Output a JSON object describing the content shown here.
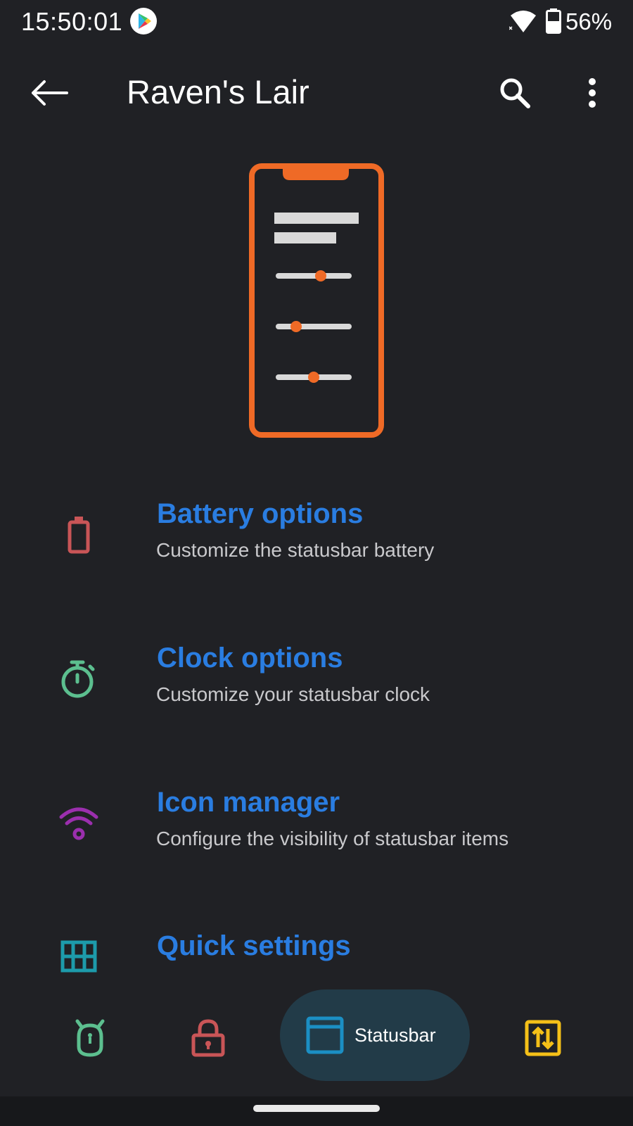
{
  "status_bar": {
    "time": "15:50:01",
    "battery_percent": "56%",
    "notification_icons": [
      "play-store-icon"
    ],
    "system_icons": [
      "wifi-icon",
      "battery-icon"
    ]
  },
  "app_bar": {
    "title": "Raven's Lair",
    "back_icon": "arrow-left-icon",
    "search_icon": "search-icon",
    "more_icon": "more-vert-icon"
  },
  "illustration": {
    "name": "phone-settings-illustration",
    "slider_levels": [
      0.6,
      0.25,
      0.5
    ],
    "accent_color": "#ef6a26"
  },
  "options": [
    {
      "title": "Battery options",
      "subtitle": "Customize the statusbar battery",
      "icon": "battery-icon",
      "color": "#c95557"
    },
    {
      "title": "Clock options",
      "subtitle": "Customize your statusbar clock",
      "icon": "stopwatch-icon",
      "color": "#5cbf8f"
    },
    {
      "title": "Icon manager",
      "subtitle": "Configure the visibility of statusbar items",
      "icon": "wifi-icon",
      "color": "#9b2fae"
    },
    {
      "title": "Quick settings",
      "subtitle": "",
      "icon": "grid-icon",
      "color": "#1d9bab"
    }
  ],
  "bottom_nav": {
    "items": [
      {
        "icon": "android-icon",
        "color": "#5cbf8f"
      },
      {
        "icon": "lock-icon",
        "color": "#c95557"
      },
      {
        "icon": "statusbar-window-icon",
        "color": "#1b8fc4",
        "label": "Statusbar",
        "active": true
      },
      {
        "icon": "swap-vert-icon",
        "color": "#f5c018"
      }
    ]
  },
  "colors": {
    "background": "#202125",
    "title_blue": "#2a7de1",
    "subtitle_gray": "#c9c9cc",
    "active_pill": "#223b48"
  }
}
